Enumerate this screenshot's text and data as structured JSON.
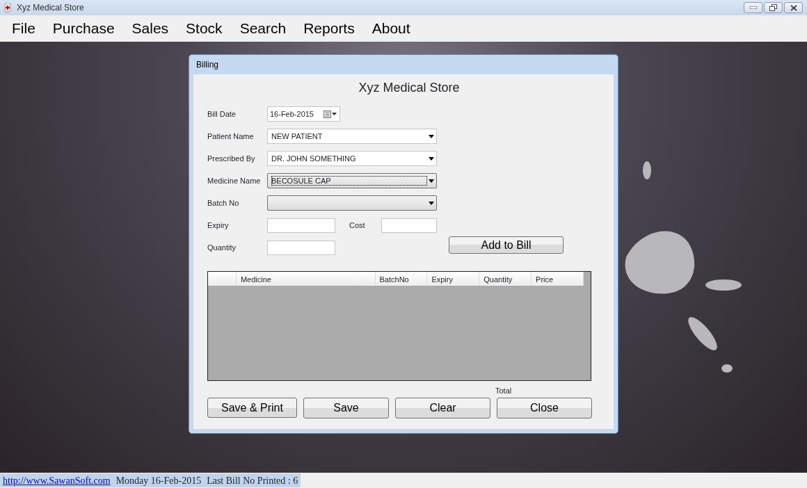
{
  "window": {
    "title": "Xyz Medical Store"
  },
  "menu": [
    "File",
    "Purchase",
    "Sales",
    "Stock",
    "Search",
    "Reports",
    "About"
  ],
  "dialog": {
    "title": "Billing",
    "heading": "Xyz Medical Store",
    "rows": [
      [
        {
          "kind": "date",
          "label": "Bill Date",
          "value": "16-Feb-2015"
        }
      ],
      [
        {
          "kind": "combo",
          "label": "Patient Name",
          "value": "NEW PATIENT",
          "editable": true,
          "focused": false
        }
      ],
      [
        {
          "kind": "combo",
          "label": "Prescribed By",
          "value": "DR. JOHN SOMETHING",
          "editable": true,
          "focused": false
        }
      ],
      [
        {
          "kind": "combo",
          "label": "Medicine Name",
          "value": "BECOSULE CAP",
          "editable": false,
          "focused": true
        }
      ],
      [
        {
          "kind": "combo",
          "label": "Batch No",
          "editable": false,
          "focused": false
        }
      ],
      [
        {
          "kind": "text",
          "label": "Expiry"
        },
        {
          "kind": "text",
          "label": "Cost"
        }
      ],
      [
        {
          "kind": "text",
          "label": "Quantity"
        },
        {
          "kind": "button",
          "label": "Add to Bill"
        }
      ]
    ],
    "grid": {
      "columns": [
        "Medicine",
        "BatchNo",
        "Expiry",
        "Quantity",
        "Price"
      ]
    },
    "total_label": "Total",
    "buttons": [
      "Save & Print",
      "Save",
      "Clear",
      "Close"
    ]
  },
  "status_bar": {
    "link": "http://www.SawanSoft.com",
    "date": "Monday 16-Feb-2015",
    "last_bill": "Last Bill No Printed : 6"
  }
}
